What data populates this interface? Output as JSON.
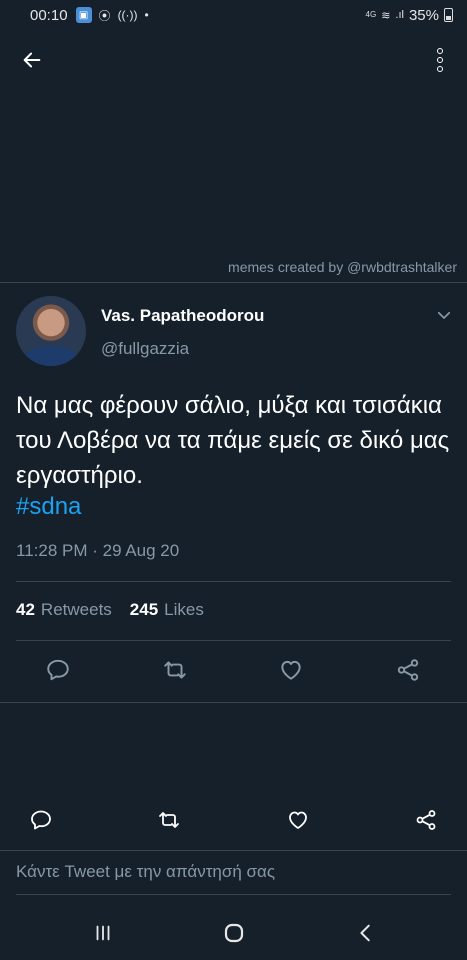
{
  "status_bar": {
    "time": "00:10",
    "network": "4G",
    "battery": "35%"
  },
  "watermark": "memes created by @rwbdtrashtalker",
  "tweet": {
    "display_name": "Vas. Papatheodorou",
    "handle": "@fullgazzia",
    "text": "Να μας φέρουν σάλιο, μύξα και τσισάκια του Λοβέρα να τα πάμε εμείς σε δικό μας εργαστήριο.",
    "hashtag": "#sdna",
    "timestamp": "11:28 PM · 29 Aug 20",
    "retweets_count": "42",
    "retweets_label": "Retweets",
    "likes_count": "245",
    "likes_label": "Likes"
  },
  "reply_placeholder": "Κάντε Tweet με την απάντησή σας",
  "icons": {
    "back": "arrow-left-icon",
    "more": "more-vertical-icon",
    "reply": "reply-icon",
    "retweet": "retweet-icon",
    "like": "heart-icon",
    "share": "share-icon"
  },
  "colors": {
    "background": "#15202b",
    "accent": "#1da1f2",
    "muted": "#8899a6",
    "divider": "#38444d"
  }
}
